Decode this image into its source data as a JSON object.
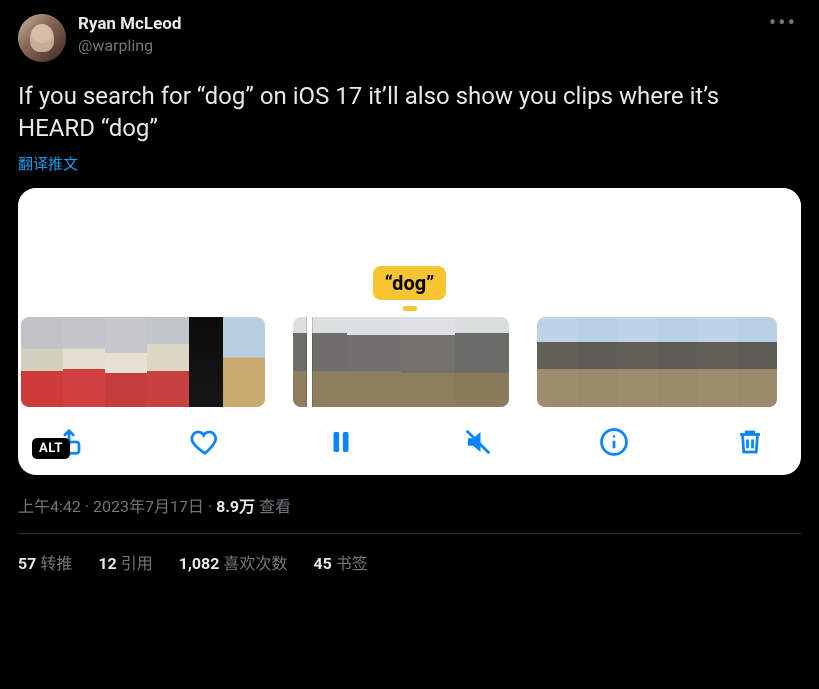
{
  "author": {
    "display_name": "Ryan McLeod",
    "handle": "@warpling"
  },
  "tweet_text": "If you search for “dog” on iOS 17 it’ll also show you clips where it’s HEARD “dog”",
  "translate_label": "翻译推文",
  "media": {
    "highlight_label": "“dog”",
    "alt_badge": "ALT"
  },
  "meta": {
    "time": "上午4:42",
    "date": "2023年7月17日",
    "views_count": "8.9万",
    "views_label": "查看",
    "separator": " · "
  },
  "stats": {
    "retweets": {
      "count": "57",
      "label": "转推"
    },
    "quotes": {
      "count": "12",
      "label": "引用"
    },
    "likes": {
      "count": "1,082",
      "label": "喜欢次数"
    },
    "bookmarks": {
      "count": "45",
      "label": "书签"
    }
  }
}
